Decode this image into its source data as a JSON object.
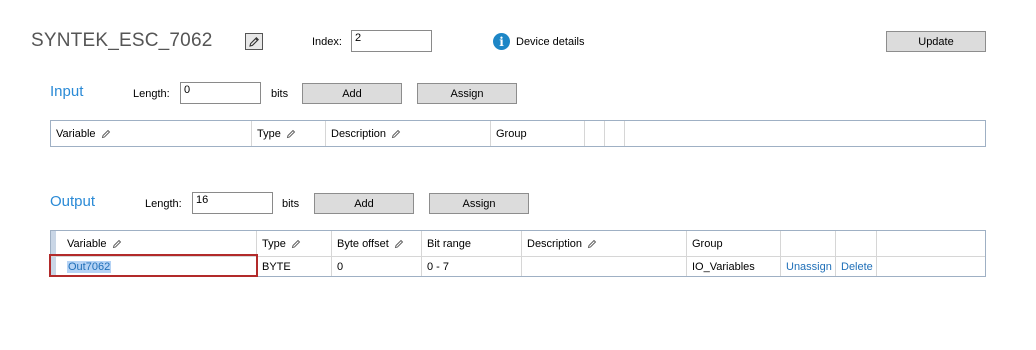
{
  "device": {
    "name": "SYNTEK_ESC_7062",
    "index_label": "Index:",
    "index_value": "2",
    "details_link": "Device details",
    "update_label": "Update"
  },
  "input": {
    "title": "Input",
    "length_label": "Length:",
    "length_value": "0",
    "unit": "bits",
    "add_label": "Add",
    "assign_label": "Assign",
    "columns": [
      "Variable",
      "Type",
      "Description",
      "Group"
    ]
  },
  "output": {
    "title": "Output",
    "length_label": "Length:",
    "length_value": "16",
    "unit": "bits",
    "add_label": "Add",
    "assign_label": "Assign",
    "columns": [
      "Variable",
      "Type",
      "Byte offset",
      "Bit range",
      "Description",
      "Group"
    ],
    "rows": [
      {
        "variable": "Out7062",
        "type": "BYTE",
        "byte_offset": "0",
        "bit_range": "0 - 7",
        "description": "",
        "group": "IO_Variables",
        "unassign": "Unassign",
        "delete": "Delete"
      }
    ]
  },
  "colors": {
    "accent": "#2a8ad6",
    "link": "#1f6fb8",
    "highlight": "#b22a2a"
  }
}
